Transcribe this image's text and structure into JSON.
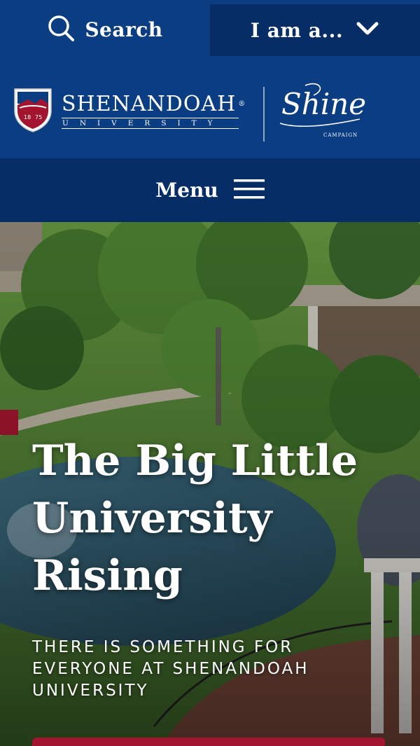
{
  "header": {
    "search_label": "Search",
    "iam_label": "I am a...",
    "logo_name": "SHENANDOAH",
    "logo_sub": "UNIVERSITY",
    "logo_reg": "®",
    "shield_year_left": "18",
    "shield_year_right": "75",
    "shine_script": "Shine",
    "shine_sub": "CAMPAIGN"
  },
  "menu": {
    "label": "Menu"
  },
  "hero": {
    "title": "The Big Little University Rising",
    "subtitle": "THERE IS SOMETHING FOR EVERYONE AT SHENANDOAH UNIVERSITY"
  },
  "colors": {
    "brand_blue": "#0b3d82",
    "brand_blue_dark": "#062d66",
    "accent_red": "#a3152e"
  },
  "icons": {
    "search": "search-icon",
    "chevron": "chevron-down-icon",
    "menu": "hamburger-icon",
    "shield": "university-shield-icon"
  }
}
